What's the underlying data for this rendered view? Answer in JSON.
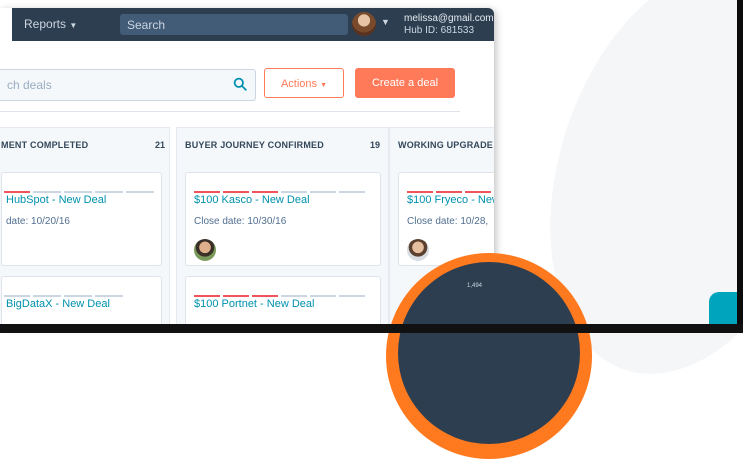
{
  "header": {
    "nav_reports": "Reports",
    "search_placeholder": "Search",
    "user_email": "melissa@gmail.com",
    "hub_id": "Hub ID: 681533"
  },
  "toolbar": {
    "search_deals_placeholder": "ch deals",
    "actions_label": "Actions",
    "create_label": "Create a deal"
  },
  "columns": [
    {
      "title": "MENT COMPLETED",
      "count": "21",
      "cards": [
        {
          "title": "HubSpot - New Deal",
          "date": "date: 10/20/16"
        },
        {
          "title": "BigDataX - New Deal",
          "date": ""
        }
      ]
    },
    {
      "title": "BUYER JOURNEY CONFIRMED",
      "count": "19",
      "cards": [
        {
          "title": "$100 Kasco - New Deal",
          "date": "Close date: 10/30/16"
        },
        {
          "title": "$100 Portnet - New Deal",
          "date": ""
        }
      ]
    },
    {
      "title": "WORKING UPGRADE",
      "count": "",
      "cards": [
        {
          "title": "$100 Fryeco - New",
          "date": "Close date: 10/28,"
        }
      ]
    }
  ],
  "overlay": {
    "stat_value": "1,494"
  },
  "colors": {
    "topbar": "#2d3e50",
    "accent_orange": "#ff7a59",
    "link_teal": "#0091ae"
  }
}
